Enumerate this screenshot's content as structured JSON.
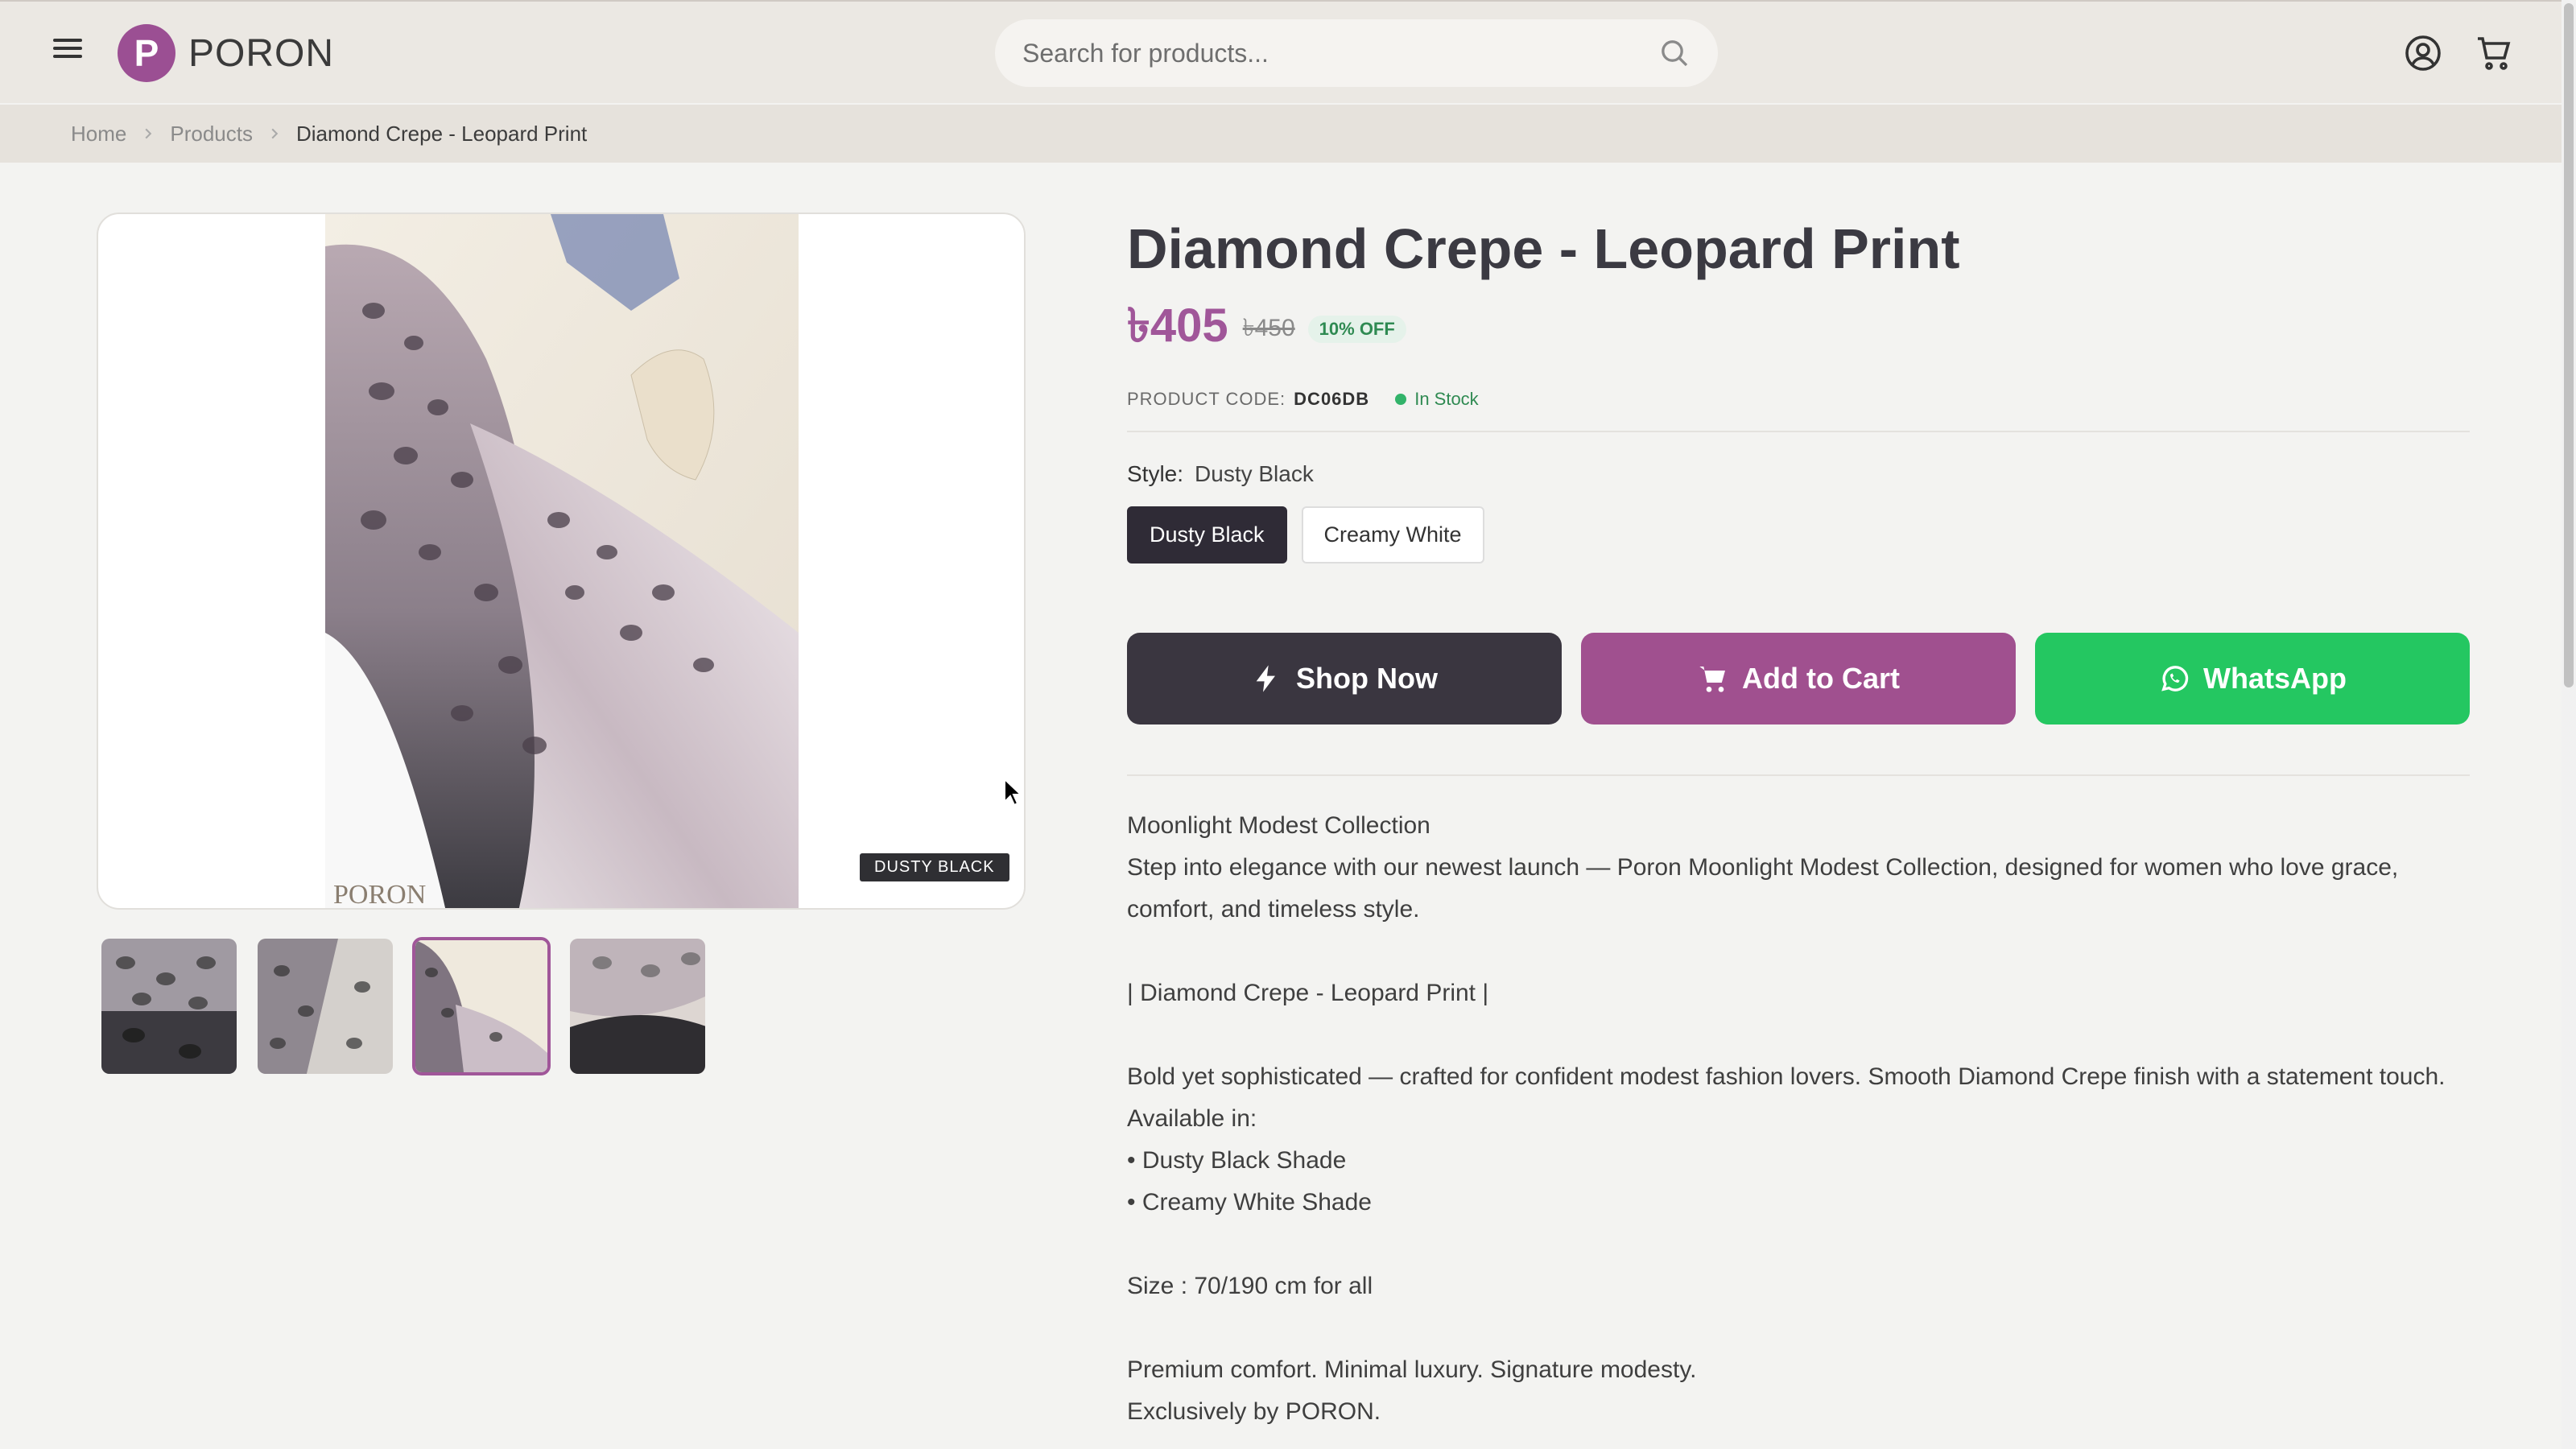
{
  "header": {
    "brand": "PORON",
    "logo_letter": "P",
    "search_placeholder": "Search for products...",
    "icons": [
      "menu-icon",
      "search-icon",
      "user-icon",
      "cart-icon"
    ]
  },
  "breadcrumb": {
    "items": [
      "Home",
      "Products"
    ],
    "current": "Diamond Crepe - Leopard Print"
  },
  "gallery": {
    "photo_watermark": "PORON",
    "style_tag": "DUSTY BLACK",
    "thumbnails": [
      "thumb-1",
      "thumb-2",
      "thumb-3",
      "thumb-4"
    ],
    "active_thumbnail_index": 2
  },
  "product": {
    "title": "Diamond Crepe - Leopard Print",
    "price": "৳405",
    "old_price": "৳450",
    "discount": "10% OFF",
    "code_label": "PRODUCT CODE:",
    "code": "DC06DB",
    "stock": "In Stock",
    "style_label": "Style:",
    "style_value": "Dusty Black",
    "style_options": [
      "Dusty Black",
      "Creamy White"
    ],
    "selected_style": "Dusty Black"
  },
  "actions": {
    "shop_now": "Shop Now",
    "add_to_cart": "Add to Cart",
    "whatsapp": "WhatsApp"
  },
  "description": {
    "l1": "Moonlight Modest Collection",
    "l2": "Step into elegance with our newest launch — Poron Moonlight Modest Collection, designed for women who love grace, comfort, and timeless style.",
    "l3": "| Diamond Crepe - Leopard Print |",
    "l4": "Bold yet sophisticated — crafted for confident modest fashion lovers. Smooth Diamond Crepe finish with a statement touch.",
    "l5": "Available in:",
    "l6": "• Dusty Black Shade",
    "l7": "• Creamy White Shade",
    "l8": "Size : 70/190 cm for all",
    "l9": "Premium comfort. Minimal luxury. Signature modesty.",
    "l10": "Exclusively by PORON."
  },
  "colors": {
    "brand": "#a0508f",
    "dark": "#3a3640",
    "whatsapp": "#24c761",
    "stock": "#32b36a"
  }
}
